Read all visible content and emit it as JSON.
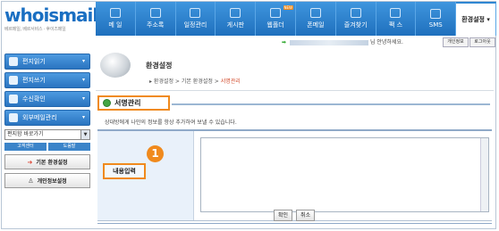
{
  "logo": {
    "main_1": "whois",
    "main_2": "mail",
    "sub": "베르메일, 베르서비스 · 후이즈메일"
  },
  "nav": [
    {
      "label": "메 일",
      "icon": "mail-icon"
    },
    {
      "label": "주소록",
      "icon": "address-book-icon"
    },
    {
      "label": "일정관리",
      "icon": "calendar-icon"
    },
    {
      "label": "게시판",
      "icon": "board-icon"
    },
    {
      "label": "웹폴더",
      "icon": "folder-icon",
      "badge": "NEW"
    },
    {
      "label": "폰메일",
      "icon": "phone-icon"
    },
    {
      "label": "즐겨찾기",
      "icon": "bookmark-icon"
    },
    {
      "label": "팩 스",
      "icon": "fax-icon"
    },
    {
      "label": "SMS",
      "icon": "sms-icon"
    },
    {
      "label": "환경설정 ▾",
      "icon": "settings-icon",
      "active": true
    }
  ],
  "userbar": {
    "greeting": "님 안녕하세요.",
    "btn_info": "개인정보",
    "btn_logout": "로그아웃"
  },
  "sidebar": {
    "items": [
      {
        "label": "편지읽기"
      },
      {
        "label": "편지쓰기"
      },
      {
        "label": "수신확인"
      },
      {
        "label": "외부메일관리"
      }
    ],
    "select_value": "편지함 바로가기",
    "tab_support": "고객센터",
    "tab_help": "도움말",
    "btn_basic": "기본 환경설정",
    "btn_personal": "개인정보설정"
  },
  "main": {
    "title": "환경설정",
    "breadcrumb_1": "환경설정",
    "breadcrumb_2": "기본 환경설정",
    "breadcrumb_3": "서명관리",
    "section_title": "서명관리",
    "description": "상대방에게 나만의 정보를 항상 추가하여 보낼 수 있습니다.",
    "label_content": "내용입력",
    "step": "1",
    "btn_ok": "확인",
    "btn_cancel": "취소"
  },
  "colors": {
    "nav_blue": "#2e86d2",
    "highlight_orange": "#f08a1d"
  }
}
